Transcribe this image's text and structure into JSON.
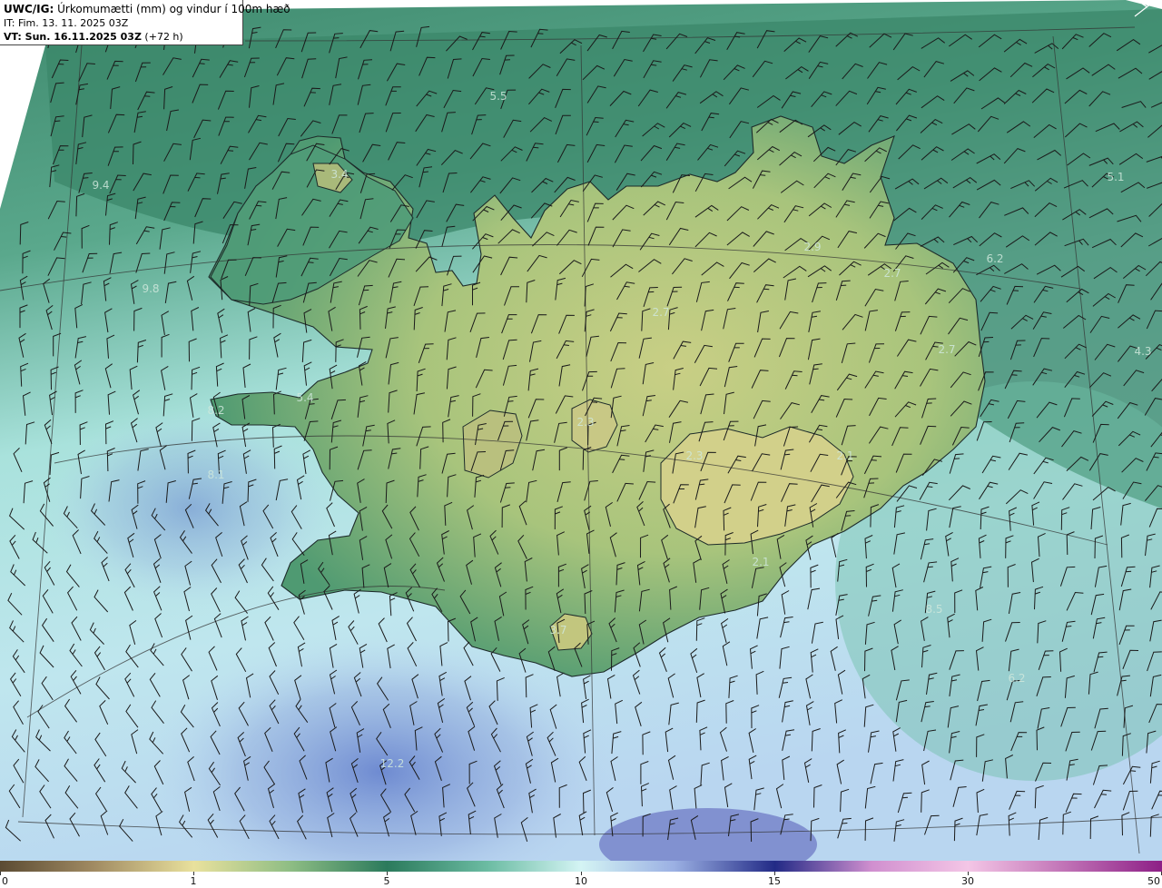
{
  "header": {
    "model": "UWC/IG:",
    "title": " Úrkomumætti (mm) og vindur í 100m hæð",
    "initial_time": "IT: Fim. 13. 11. 2025 03Z",
    "valid_label": "VT: Sun. 16.11.2025 03Z",
    "lead": " (+72 h)"
  },
  "map_labels": [
    {
      "text": "5.5"
    },
    {
      "text": "5.1"
    },
    {
      "text": "9.4"
    },
    {
      "text": "3.4"
    },
    {
      "text": "2.9"
    },
    {
      "text": "6.2"
    },
    {
      "text": "2.7"
    },
    {
      "text": "9.8"
    },
    {
      "text": "2.7"
    },
    {
      "text": "2.7"
    },
    {
      "text": "4.3"
    },
    {
      "text": "5.4"
    },
    {
      "text": "8.2"
    },
    {
      "text": "2.3"
    },
    {
      "text": "2.3"
    },
    {
      "text": "2.1"
    },
    {
      "text": "8.1"
    },
    {
      "text": "2.1"
    },
    {
      "text": "8.5"
    },
    {
      "text": "3.7"
    },
    {
      "text": "6.2"
    },
    {
      "text": "12.2"
    }
  ],
  "colorbar": {
    "unit": "mm",
    "ticks": [
      "0",
      "1",
      "5",
      "10",
      "15",
      "30",
      "50"
    ],
    "colors": {
      "low": "#6b5a3e",
      "tan": "#e6df9a",
      "green": "#2e7a5e",
      "cyan": "#c9f1ef",
      "blue": "#3b3fa6",
      "pink": "#f2b3e0",
      "purple": "#a02c9a"
    }
  },
  "icons": {
    "corner_mark": "wind-barb-icon"
  }
}
